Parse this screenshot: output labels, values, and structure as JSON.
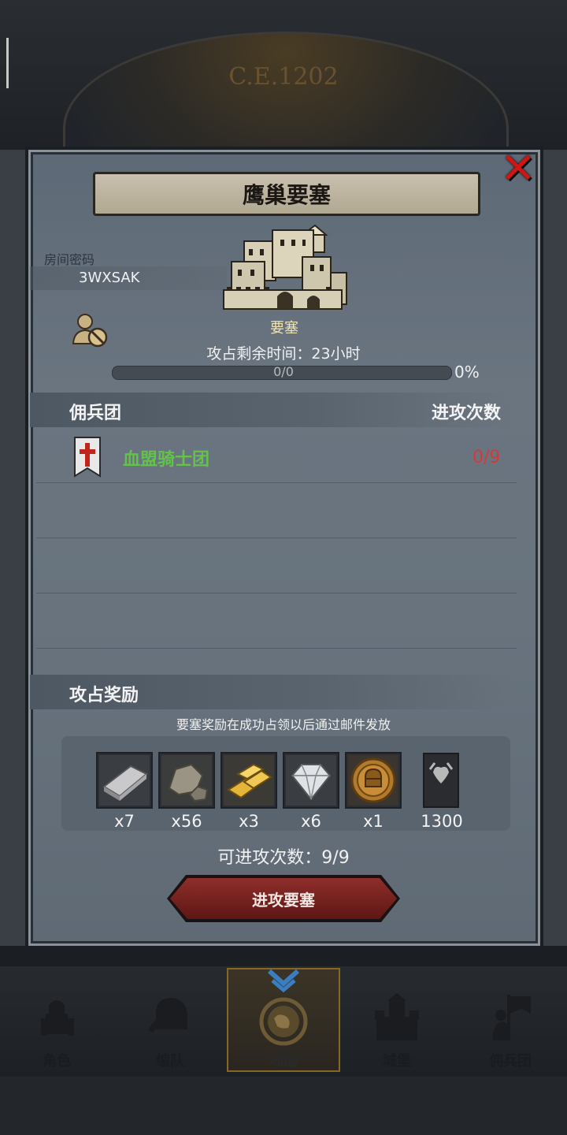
{
  "background": {
    "year": "C.E.1202"
  },
  "dialog": {
    "title": "鹰巢要塞",
    "room_code_label": "房间密码",
    "room_code": "3WXSAK",
    "fort_label": "要塞",
    "timer_text": "攻占剩余时间：23小时",
    "progress_text": "0/0",
    "progress_percent": "0%",
    "progress_value": 0,
    "mercenary_header": "佣兵团",
    "attack_count_header": "进攻次数",
    "guilds": [
      {
        "name": "血盟骑士团",
        "count": "0/9"
      }
    ],
    "reward_header": "攻占奖励",
    "reward_note": "要塞奖励在成功占领以后通过邮件发放",
    "rewards": [
      {
        "icon": "silver-ingot-icon",
        "qty": "x7"
      },
      {
        "icon": "stone-icon",
        "qty": "x56"
      },
      {
        "icon": "gold-bars-icon",
        "qty": "x3"
      },
      {
        "icon": "diamond-icon",
        "qty": "x6"
      },
      {
        "icon": "knight-coin-icon",
        "qty": "x1"
      },
      {
        "icon": "experience-banner-icon",
        "qty": "1300"
      }
    ],
    "attacks_remaining": "可进攻次数：9/9",
    "attack_button": "进攻要塞"
  },
  "nav": [
    {
      "label": "角色",
      "icon": "knight-icon"
    },
    {
      "label": "编队",
      "icon": "helmet-icon"
    },
    {
      "label": "地图",
      "icon": "map-icon"
    },
    {
      "label": "城堡",
      "icon": "castle-icon"
    },
    {
      "label": "佣兵团",
      "icon": "mercenary-icon"
    }
  ],
  "colors": {
    "guild_name": "#63c24a",
    "attack_count": "#d23a3a",
    "close": "#d01515",
    "attack_button": "#8e2e2a"
  }
}
